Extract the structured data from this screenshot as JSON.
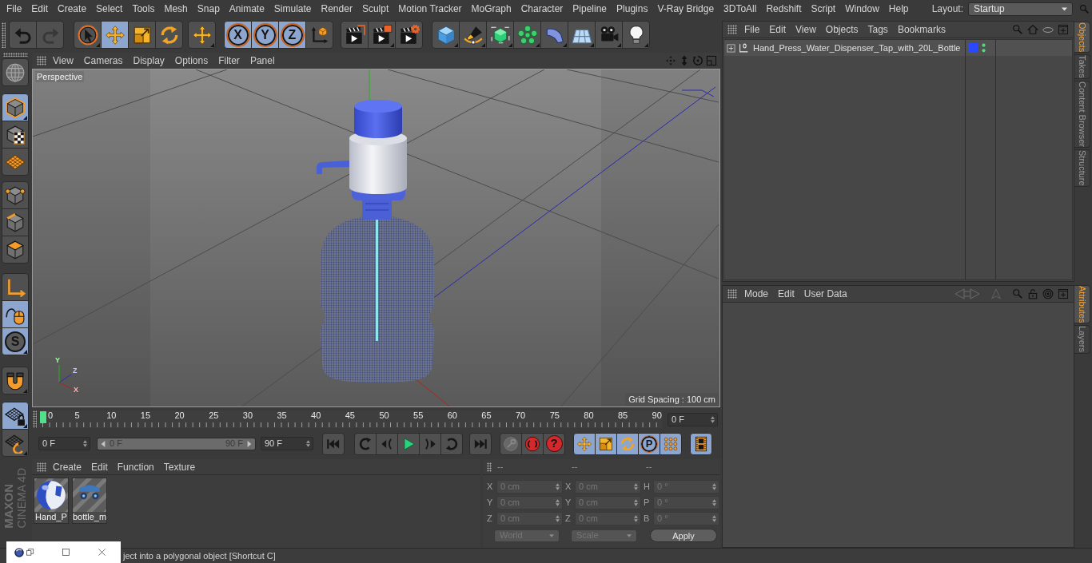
{
  "menu_bar": {
    "items": [
      "File",
      "Edit",
      "Create",
      "Select",
      "Tools",
      "Mesh",
      "Snap",
      "Animate",
      "Simulate",
      "Render",
      "Sculpt",
      "Motion Tracker",
      "MoGraph",
      "Character",
      "Pipeline",
      "Plugins",
      "V-Ray Bridge",
      "3DToAll",
      "Redshift",
      "Script",
      "Window",
      "Help"
    ],
    "layout_label": "Layout:",
    "layout_value": "Startup"
  },
  "toolbar": {
    "groups": [
      [
        {
          "kind": "undo",
          "selected": false,
          "disabled": false,
          "flyout": false
        },
        {
          "kind": "redo",
          "selected": false,
          "disabled": true,
          "flyout": false
        }
      ],
      [
        {
          "kind": "select",
          "selected": false,
          "disabled": false,
          "flyout": true
        },
        {
          "kind": "move",
          "selected": true,
          "disabled": false,
          "flyout": false
        },
        {
          "kind": "scale",
          "selected": false,
          "disabled": false,
          "flyout": false
        },
        {
          "kind": "rotate",
          "selected": false,
          "disabled": false,
          "flyout": false
        }
      ],
      [
        {
          "kind": "recent",
          "selected": false,
          "disabled": false,
          "flyout": true
        }
      ],
      [
        {
          "kind": "axislock",
          "label": "X",
          "selected": true,
          "disabled": false,
          "flyout": false
        },
        {
          "kind": "axislock",
          "label": "Y",
          "selected": true,
          "disabled": false,
          "flyout": false
        },
        {
          "kind": "axislock",
          "label": "Z",
          "selected": true,
          "disabled": false,
          "flyout": false
        },
        {
          "kind": "coords",
          "selected": false,
          "disabled": false,
          "flyout": false
        }
      ],
      [
        {
          "kind": "renderview",
          "selected": false,
          "disabled": false,
          "flyout": false
        },
        {
          "kind": "renderpv",
          "selected": false,
          "disabled": false,
          "flyout": true
        },
        {
          "kind": "rendersettings",
          "selected": false,
          "disabled": false,
          "flyout": false
        }
      ],
      [
        {
          "kind": "cube",
          "selected": false,
          "disabled": false,
          "flyout": true
        },
        {
          "kind": "pen",
          "selected": false,
          "disabled": false,
          "flyout": true
        },
        {
          "kind": "subdivision",
          "selected": false,
          "disabled": false,
          "flyout": true
        },
        {
          "kind": "cloner",
          "selected": false,
          "disabled": false,
          "flyout": true
        },
        {
          "kind": "bend",
          "selected": false,
          "disabled": false,
          "flyout": true
        },
        {
          "kind": "floor",
          "selected": false,
          "disabled": false,
          "flyout": true
        },
        {
          "kind": "camera",
          "selected": false,
          "disabled": false,
          "flyout": true
        },
        {
          "kind": "light",
          "selected": false,
          "disabled": false,
          "flyout": true
        }
      ]
    ]
  },
  "left_toolbar": {
    "groups": [
      [
        {
          "kind": "globe",
          "selected": false,
          "disabled": false,
          "flyout": false
        }
      ],
      [
        {
          "kind": "model",
          "selected": true,
          "disabled": false,
          "flyout": true
        },
        {
          "kind": "texture",
          "selected": false,
          "disabled": false,
          "flyout": false
        },
        {
          "kind": "workplane",
          "selected": false,
          "disabled": false,
          "flyout": false
        }
      ],
      [
        {
          "kind": "points",
          "selected": false,
          "disabled": false,
          "flyout": false
        },
        {
          "kind": "edges",
          "selected": false,
          "disabled": false,
          "flyout": false
        },
        {
          "kind": "polygons",
          "selected": false,
          "disabled": false,
          "flyout": false
        }
      ],
      [
        {
          "kind": "axis",
          "selected": false,
          "disabled": false,
          "flyout": false
        },
        {
          "kind": "tweak",
          "selected": true,
          "disabled": false,
          "flyout": false
        },
        {
          "kind": "snap",
          "label": "S",
          "selected": true,
          "disabled": false,
          "flyout": true
        }
      ],
      [
        {
          "kind": "magnet",
          "selected": false,
          "disabled": false,
          "flyout": true
        }
      ],
      [
        {
          "kind": "lockgrid",
          "selected": true,
          "disabled": false,
          "flyout": true
        },
        {
          "kind": "gridrotate",
          "selected": false,
          "disabled": false,
          "flyout": true
        }
      ]
    ]
  },
  "logo": {
    "brand": "MAXON",
    "product": "CINEMA 4D"
  },
  "viewport": {
    "menu": [
      "View",
      "Cameras",
      "Display",
      "Options",
      "Filter",
      "Panel"
    ],
    "camera": "Perspective",
    "grid_spacing": "Grid Spacing : 100 cm",
    "gizmo_labels": [
      "Y",
      "Z",
      "X"
    ]
  },
  "timeline": {
    "ticks": [
      "0",
      "5",
      "10",
      "15",
      "20",
      "25",
      "30",
      "35",
      "40",
      "45",
      "50",
      "55",
      "60",
      "65",
      "70",
      "75",
      "80",
      "85",
      "90"
    ],
    "playhead": {
      "level": 0
    },
    "current_frame": "0 F"
  },
  "playback": {
    "start": "0 F",
    "range": {
      "start": "0 F",
      "end": "90 F",
      "level": 1
    },
    "end": "90 F",
    "groups": [
      [
        {
          "kind": "gostart",
          "selected": false,
          "disabled": false
        }
      ],
      [
        {
          "kind": "prevkey",
          "selected": false,
          "disabled": false
        },
        {
          "kind": "prevframe",
          "selected": false,
          "disabled": false
        },
        {
          "kind": "play",
          "selected": false,
          "disabled": false
        },
        {
          "kind": "nextframe",
          "selected": false,
          "disabled": false
        },
        {
          "kind": "nextkey",
          "selected": false,
          "disabled": false
        }
      ],
      [
        {
          "kind": "goend",
          "selected": false,
          "disabled": false
        }
      ],
      [
        {
          "kind": "record",
          "selected": false,
          "disabled": true
        },
        {
          "kind": "autokey",
          "selected": false,
          "disabled": false
        },
        {
          "kind": "keyhelp",
          "label": "?",
          "selected": false,
          "disabled": false
        }
      ],
      [
        {
          "kind": "movekey",
          "selected": true,
          "disabled": false
        },
        {
          "kind": "scalekey",
          "selected": true,
          "disabled": false
        },
        {
          "kind": "rotatekey",
          "selected": true,
          "disabled": false
        },
        {
          "kind": "paramkey",
          "label": "P",
          "selected": true,
          "disabled": false
        },
        {
          "kind": "pla",
          "selected": true,
          "disabled": false
        }
      ],
      [
        {
          "kind": "film",
          "selected": true,
          "disabled": false
        }
      ]
    ]
  },
  "materials": {
    "menu": [
      "Create",
      "Edit",
      "Function",
      "Texture"
    ],
    "items": [
      {
        "kind": "sphere",
        "name": "Hand_P",
        "selected": false
      },
      {
        "kind": "preview",
        "name": "bottle_m",
        "selected": false
      }
    ]
  },
  "coordinates": {
    "headers": [
      "--",
      "--",
      "--"
    ],
    "disabled": true,
    "rows": [
      {
        "labels": [
          "X",
          "X",
          "H"
        ],
        "values": [
          "0 cm",
          "0 cm",
          "0 °"
        ]
      },
      {
        "labels": [
          "Y",
          "Y",
          "P"
        ],
        "values": [
          "0 cm",
          "0 cm",
          "0 °"
        ]
      },
      {
        "labels": [
          "Z",
          "Z",
          "B"
        ],
        "values": [
          "0 cm",
          "0 cm",
          "0 °"
        ]
      }
    ],
    "mode": "World",
    "size_mode": "Scale",
    "apply": "Apply"
  },
  "status_bar": {
    "text": "ject into a polygonal object [Shortcut C]"
  },
  "objects": {
    "menu": [
      "File",
      "Edit",
      "View",
      "Objects",
      "Tags",
      "Bookmarks"
    ],
    "rows": [
      {
        "name": "Hand_Press_Water_Dispenser_Tap_with_20L_Bottle",
        "expanded": false,
        "selected": false
      }
    ]
  },
  "attributes": {
    "menu": [
      "Mode",
      "Edit",
      "User Data"
    ],
    "history_disabled": true
  },
  "side_tabs": {
    "top": [
      {
        "label": "Objects",
        "selected": true
      },
      {
        "label": "Takes",
        "selected": false
      },
      {
        "label": "Content Browser",
        "selected": false
      },
      {
        "label": "Structure",
        "selected": false
      }
    ],
    "bottom": [
      {
        "label": "Attributes",
        "selected": true
      },
      {
        "label": "Layers",
        "selected": false
      }
    ]
  }
}
